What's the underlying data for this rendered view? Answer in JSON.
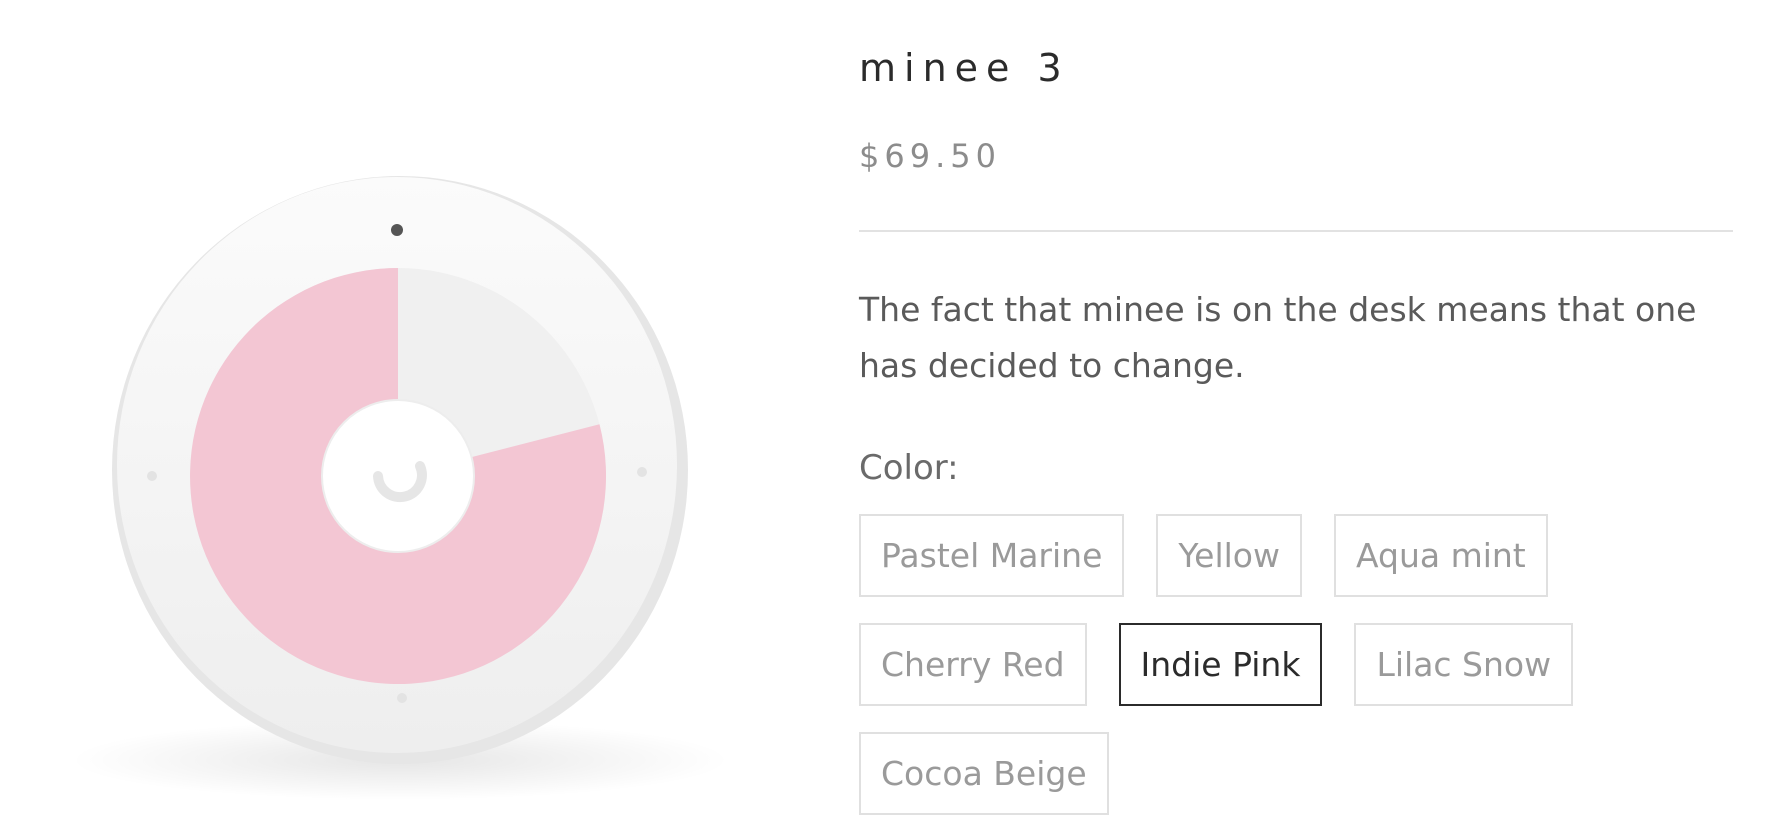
{
  "product": {
    "title": "minee 3",
    "price": "$69.50",
    "description": "The fact that minee is on the desk means that one has decided to change."
  },
  "options": {
    "color_label": "Color:",
    "colors": [
      {
        "label": "Pastel Marine",
        "selected": false
      },
      {
        "label": "Yellow",
        "selected": false
      },
      {
        "label": "Aqua mint",
        "selected": false
      },
      {
        "label": "Cherry Red",
        "selected": false
      },
      {
        "label": "Indie Pink",
        "selected": true
      },
      {
        "label": "Lilac Snow",
        "selected": false
      },
      {
        "label": "Cocoa Beige",
        "selected": false
      }
    ]
  },
  "image": {
    "subject": "minee 3 timer",
    "dial_color": "#f3c6d3",
    "body_color": "#f4f4f4",
    "remaining_fraction": 0.79
  }
}
